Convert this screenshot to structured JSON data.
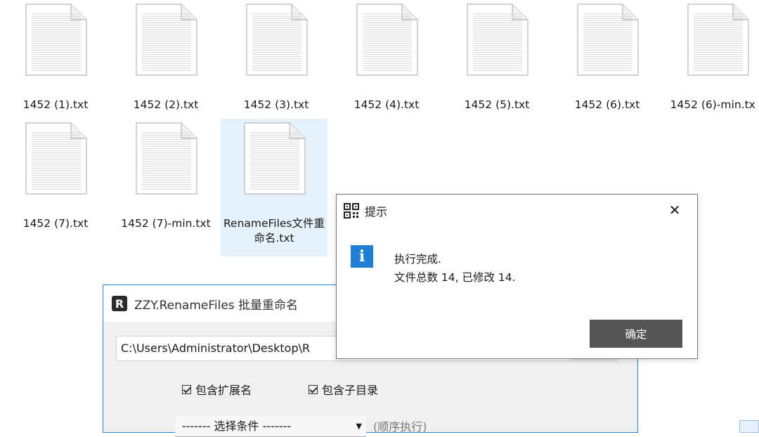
{
  "files": [
    {
      "name": "1452 (1).txt"
    },
    {
      "name": "1452 (2).txt"
    },
    {
      "name": "1452 (3).txt"
    },
    {
      "name": "1452 (4).txt"
    },
    {
      "name": "1452 (5).txt"
    },
    {
      "name": "1452 (6).txt"
    },
    {
      "name": "1452 (6)-min.tx"
    },
    {
      "name": "1452 (7).txt"
    },
    {
      "name": "1452 (7)-min.txt"
    },
    {
      "name": "RenameFiles文件重命名.txt"
    }
  ],
  "app": {
    "title": "ZZY.RenameFiles 批量重命名",
    "logo_letter": "R",
    "path_value": "C:\\Users\\Administrator\\Desktop\\R",
    "checkbox_ext": "包含扩展名",
    "checkbox_subdir": "包含子目录",
    "select_value": "------- 选择条件 -------",
    "order_label": "(顺序执行)"
  },
  "dialog": {
    "title": "提示",
    "message_line1": "执行完成.",
    "message_line2": "文件总数 14, 已修改 14.",
    "ok_label": "确定",
    "close_glyph": "✕",
    "info_glyph": "i"
  },
  "colors": {
    "selection": "#e5f1fb",
    "accent": "#1e7fd4",
    "button": "#555555"
  }
}
